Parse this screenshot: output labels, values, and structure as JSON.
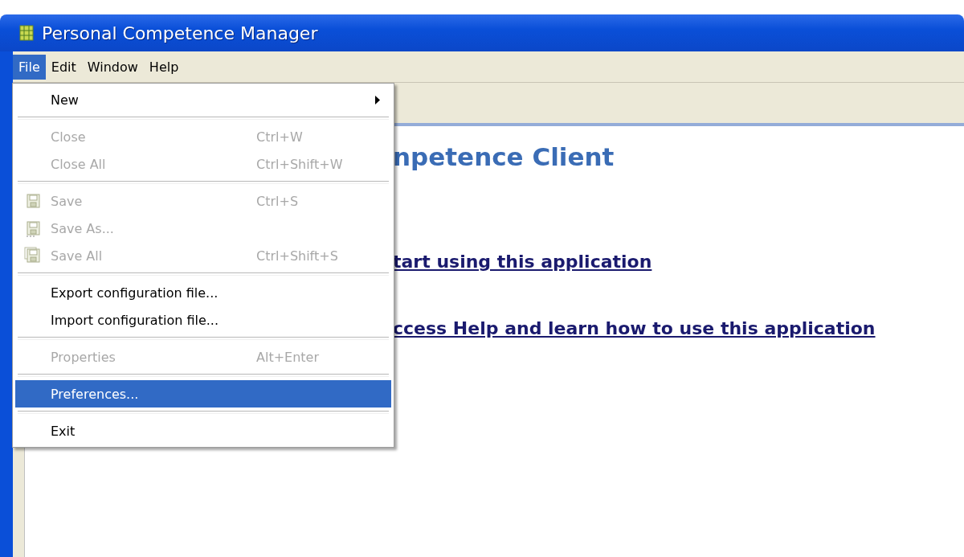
{
  "window": {
    "title": "Personal Competence Manager"
  },
  "menubar": [
    {
      "label": "File",
      "selected": true
    },
    {
      "label": "Edit",
      "selected": false
    },
    {
      "label": "Window",
      "selected": false
    },
    {
      "label": "Help",
      "selected": false
    }
  ],
  "file_menu": [
    {
      "kind": "item",
      "label": "New",
      "submenu": true,
      "disabled": false,
      "selected": false
    },
    {
      "kind": "separator"
    },
    {
      "kind": "item",
      "label": "Close",
      "shortcut": "Ctrl+W",
      "disabled": true,
      "selected": false
    },
    {
      "kind": "item",
      "label": "Close All",
      "shortcut": "Ctrl+Shift+W",
      "disabled": true,
      "selected": false
    },
    {
      "kind": "separator"
    },
    {
      "kind": "icon_item",
      "label": "Save",
      "shortcut": "Ctrl+S",
      "disabled": true,
      "selected": false
    },
    {
      "kind": "icon_item",
      "label": "Save As...",
      "disabled": true,
      "selected": false
    },
    {
      "kind": "icon_item",
      "label": "Save All",
      "shortcut": "Ctrl+Shift+S",
      "disabled": true,
      "selected": false
    },
    {
      "kind": "separator"
    },
    {
      "kind": "item",
      "label": "Export configuration file...",
      "disabled": false,
      "selected": false
    },
    {
      "kind": "item",
      "label": "Import configuration file...",
      "disabled": false,
      "selected": false
    },
    {
      "kind": "separator"
    },
    {
      "kind": "item",
      "label": "Properties",
      "shortcut": "Alt+Enter",
      "disabled": true,
      "selected": false
    },
    {
      "kind": "separator"
    },
    {
      "kind": "item",
      "label": "Preferences...",
      "disabled": false,
      "selected": true
    },
    {
      "kind": "separator"
    },
    {
      "kind": "item",
      "label": "Exit",
      "disabled": false,
      "selected": false
    }
  ],
  "welcome": {
    "heading": "npetence Client",
    "links": [
      "tart using this application",
      "ccess Help and learn how to use this application"
    ]
  }
}
